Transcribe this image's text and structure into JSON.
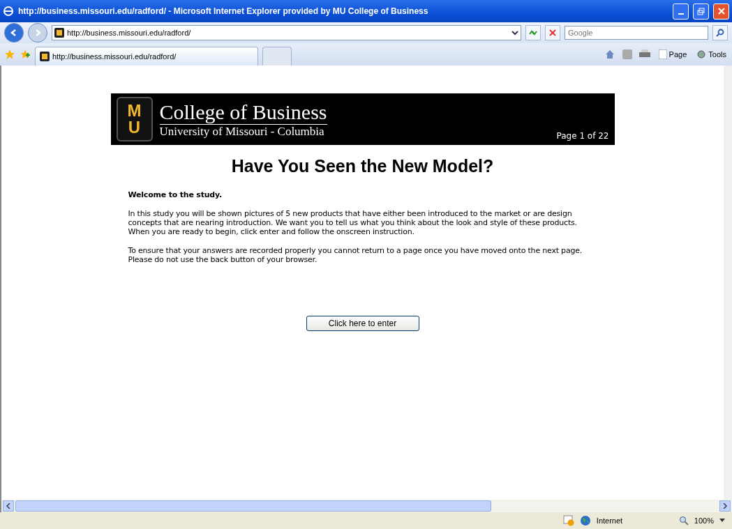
{
  "window": {
    "title": "http://business.missouri.edu/radford/ - Microsoft Internet Explorer provided by MU College of Business"
  },
  "address_bar": {
    "value": "http://business.missouri.edu/radford/"
  },
  "search": {
    "placeholder": "Google"
  },
  "tabs": [
    {
      "label": "http://business.missouri.edu/radford/",
      "selected": true
    },
    {
      "selected": false
    }
  ],
  "command_bar": [
    {
      "label": "Page",
      "kind": "page"
    },
    {
      "label": "Tools",
      "kind": "tools"
    }
  ],
  "banner": {
    "logo_letters": [
      "M",
      "U"
    ],
    "title": "College of Business",
    "subtitle": "University of Missouri - Columbia",
    "page_indicator": "Page 1 of 22"
  },
  "heading": "Have You Seen the New Model?",
  "intro": "Welcome to the study.",
  "paragraphs": [
    "In this study you will be shown pictures of 5 new products that have either been introduced to the market or are design concepts that are nearing introduction. We want you to tell us what you think about the look and style of these products. When you are ready to begin, click enter and follow the onscreen instruction.",
    "To ensure that your answers are recorded properly you cannot return to a page once you have moved onto the next page. Please do not use the back button of your browser."
  ],
  "enter_button": "Click here to enter",
  "status_bar": {
    "zone": "Internet",
    "zoom": "100%"
  }
}
